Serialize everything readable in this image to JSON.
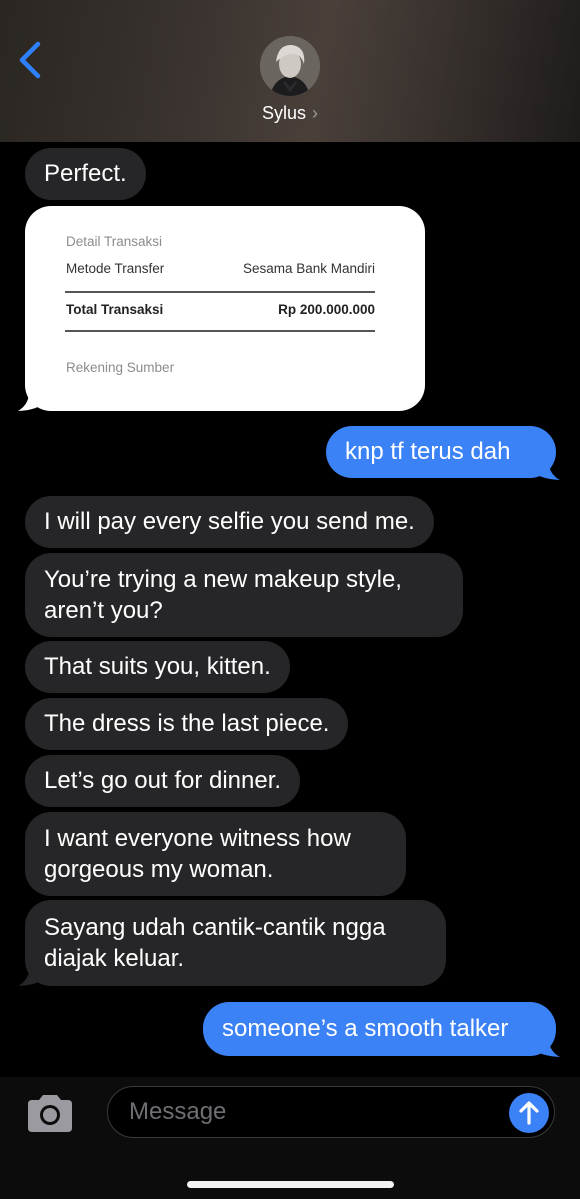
{
  "header": {
    "contact_name": "Sylus",
    "chevron": "›"
  },
  "receipt": {
    "section_title": "Detail Transaksi",
    "method_label": "Metode Transfer",
    "method_value": "Sesama Bank Mandiri",
    "total_label": "Total Transaksi",
    "total_value": "Rp 200.000.000",
    "source_label": "Rekening Sumber"
  },
  "messages": [
    {
      "from": "them",
      "text": "Perfect."
    },
    {
      "from": "me",
      "text": "knp tf terus dah"
    },
    {
      "from": "them",
      "text": "I will pay every selfie you send me."
    },
    {
      "from": "them",
      "line1": "You’re trying a new makeup style,",
      "line2": "aren’t you?"
    },
    {
      "from": "them",
      "text": "That suits you, kitten."
    },
    {
      "from": "them",
      "text": "The dress is the last piece."
    },
    {
      "from": "them",
      "text": "Let’s go out for dinner."
    },
    {
      "from": "them",
      "line1": "I want everyone witness how",
      "line2": "gorgeous my woman."
    },
    {
      "from": "them",
      "line1": "Sayang udah cantik-cantik ngga",
      "line2": "diajak keluar."
    },
    {
      "from": "me",
      "text": "someone’s a smooth talker"
    }
  ],
  "composer": {
    "placeholder": "Message"
  },
  "icons": {
    "back": "chevron-left-icon",
    "camera": "camera-icon",
    "send": "arrow-up-icon"
  },
  "colors": {
    "accent": "#3b82f6",
    "received_bubble": "#262628",
    "background": "#000000"
  }
}
